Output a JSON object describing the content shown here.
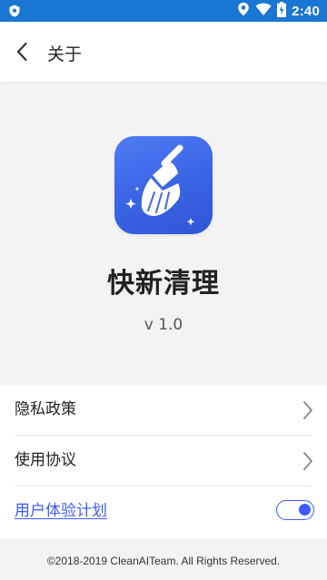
{
  "status_bar": {
    "time": "2:40",
    "background_color": "#1976d2",
    "icons": [
      "shield-notification-icon",
      "location-icon",
      "wifi-icon",
      "battery-charging-icon"
    ]
  },
  "header": {
    "title": "关于",
    "back_icon": "chevron-left-icon"
  },
  "app": {
    "name": "快新清理",
    "version": "v 1.0",
    "icon": "broom-sparkle-icon",
    "icon_color": "#3a63e4"
  },
  "settings": {
    "items": [
      {
        "label": "隐私政策",
        "icon": "chevron-right-icon"
      },
      {
        "label": "使用协议",
        "icon": "chevron-right-icon"
      },
      {
        "label": "用户体验计划",
        "toggle_on": true,
        "accent_color": "#3d5afe"
      }
    ]
  },
  "footer": {
    "copyright": "©2018-2019 CleanAITeam. All Rights Reserved."
  }
}
